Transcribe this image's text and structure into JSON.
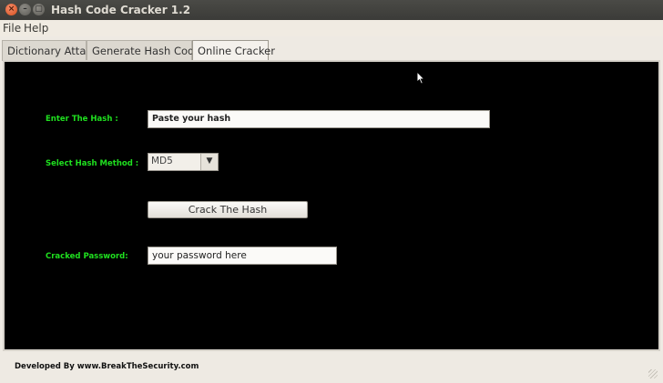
{
  "window": {
    "title": "Hash Code Cracker 1.2",
    "controls": {
      "close": "×",
      "minimize": "–",
      "maximize": "▢"
    }
  },
  "menu": {
    "file": "File",
    "help": "Help"
  },
  "tabs": [
    {
      "label": "Dictionary Attack",
      "active": false
    },
    {
      "label": "Generate Hash Codes",
      "active": false
    },
    {
      "label": "Online Cracker",
      "active": true
    }
  ],
  "form": {
    "hash_label": "Enter The Hash :",
    "hash_value": "Paste your hash",
    "method_label": "Select Hash Method :",
    "method_value": "MD5",
    "method_arrow": "▼",
    "crack_button": "Crack The Hash",
    "password_label": "Cracked Password:",
    "password_value": "your password here"
  },
  "footer": {
    "credit": "Developed By www.BreakTheSecurity.com"
  },
  "colors": {
    "label_green": "#1fe01f",
    "panel_bg": "#000000",
    "frame_bg": "#eeeae3"
  }
}
